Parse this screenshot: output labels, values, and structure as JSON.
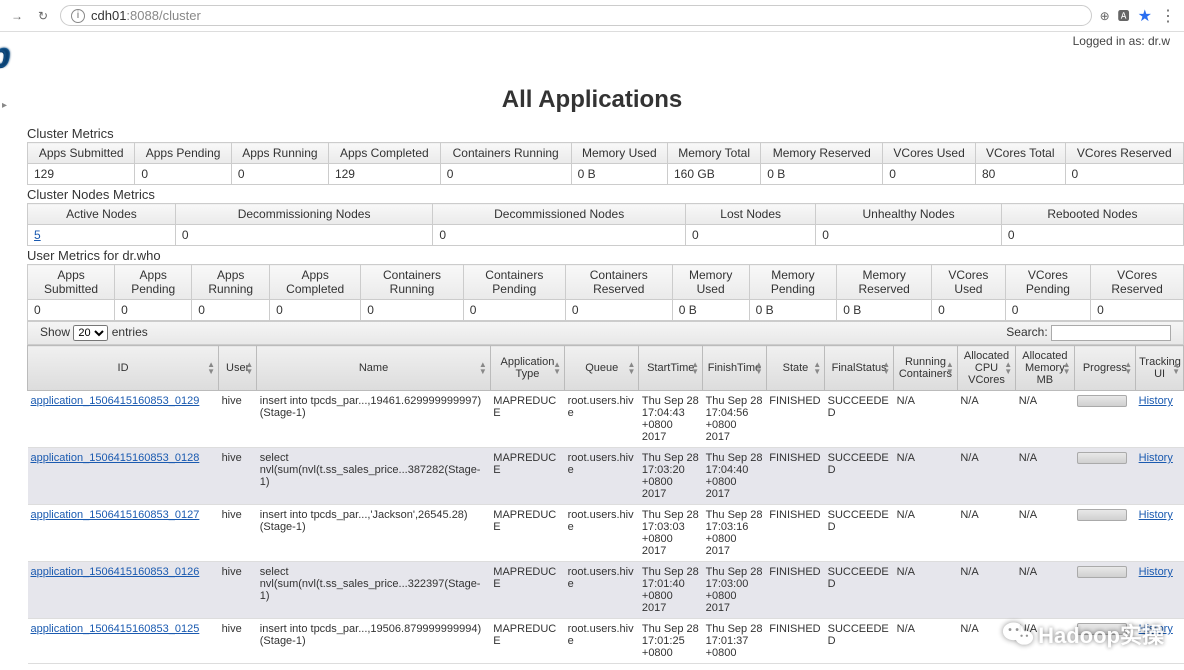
{
  "browser": {
    "url_host": "cdh01",
    "url_rest": ":8088/cluster"
  },
  "logged_in": "Logged in as: dr.w",
  "logo_text": "op",
  "page_title": "All Applications",
  "sections": {
    "cluster_metrics": "Cluster Metrics",
    "cluster_nodes": "Cluster Nodes Metrics",
    "user_metrics": "User Metrics for dr.who"
  },
  "cluster_metrics": {
    "headers": [
      "Apps Submitted",
      "Apps Pending",
      "Apps Running",
      "Apps Completed",
      "Containers Running",
      "Memory Used",
      "Memory Total",
      "Memory Reserved",
      "VCores Used",
      "VCores Total",
      "VCores Reserved"
    ],
    "values": [
      "129",
      "0",
      "0",
      "129",
      "0",
      "0 B",
      "160 GB",
      "0 B",
      "0",
      "80",
      "0"
    ]
  },
  "nodes_metrics": {
    "headers": [
      "Active Nodes",
      "Decommissioning Nodes",
      "Decommissioned Nodes",
      "Lost Nodes",
      "Unhealthy Nodes",
      "Rebooted Nodes"
    ],
    "values": [
      "5",
      "0",
      "0",
      "0",
      "0",
      "0"
    ],
    "link_idx": 0
  },
  "user_metrics": {
    "headers": [
      "Apps Submitted",
      "Apps Pending",
      "Apps Running",
      "Apps Completed",
      "Containers Running",
      "Containers Pending",
      "Containers Reserved",
      "Memory Used",
      "Memory Pending",
      "Memory Reserved",
      "VCores Used",
      "VCores Pending",
      "VCores Reserved"
    ],
    "values": [
      "0",
      "0",
      "0",
      "0",
      "0",
      "0",
      "0",
      "0 B",
      "0 B",
      "0 B",
      "0",
      "0",
      "0"
    ]
  },
  "table_controls": {
    "show_prefix": "Show",
    "show_value": "20",
    "show_suffix": "entries",
    "search_label": "Search:"
  },
  "apps_headers": [
    "ID",
    "User",
    "Name",
    "Application Type",
    "Queue",
    "StartTime",
    "FinishTime",
    "State",
    "FinalStatus",
    "Running Containers",
    "Allocated CPU VCores",
    "Allocated Memory MB",
    "Progress",
    "Tracking UI"
  ],
  "apps": [
    {
      "id": "application_1506415160853_0129",
      "user": "hive",
      "name": "insert into tpcds_par...,19461.629999999997)(Stage-1)",
      "type": "MAPREDUCE",
      "queue": "root.users.hive",
      "start": "Thu Sep 28 17:04:43 +0800 2017",
      "finish": "Thu Sep 28 17:04:56 +0800 2017",
      "state": "FINISHED",
      "final": "SUCCEEDED",
      "running": "N/A",
      "cpu": "N/A",
      "mem": "N/A",
      "track": "History"
    },
    {
      "id": "application_1506415160853_0128",
      "user": "hive",
      "name": "select nvl(sum(nvl(t.ss_sales_price...387282(Stage-1)",
      "type": "MAPREDUCE",
      "queue": "root.users.hive",
      "start": "Thu Sep 28 17:03:20 +0800 2017",
      "finish": "Thu Sep 28 17:04:40 +0800 2017",
      "state": "FINISHED",
      "final": "SUCCEEDED",
      "running": "N/A",
      "cpu": "N/A",
      "mem": "N/A",
      "track": "History"
    },
    {
      "id": "application_1506415160853_0127",
      "user": "hive",
      "name": "insert into tpcds_par...,'Jackson',26545.28)(Stage-1)",
      "type": "MAPREDUCE",
      "queue": "root.users.hive",
      "start": "Thu Sep 28 17:03:03 +0800 2017",
      "finish": "Thu Sep 28 17:03:16 +0800 2017",
      "state": "FINISHED",
      "final": "SUCCEEDED",
      "running": "N/A",
      "cpu": "N/A",
      "mem": "N/A",
      "track": "History"
    },
    {
      "id": "application_1506415160853_0126",
      "user": "hive",
      "name": "select nvl(sum(nvl(t.ss_sales_price...322397(Stage-1)",
      "type": "MAPREDUCE",
      "queue": "root.users.hive",
      "start": "Thu Sep 28 17:01:40 +0800 2017",
      "finish": "Thu Sep 28 17:03:00 +0800 2017",
      "state": "FINISHED",
      "final": "SUCCEEDED",
      "running": "N/A",
      "cpu": "N/A",
      "mem": "N/A",
      "track": "History"
    },
    {
      "id": "application_1506415160853_0125",
      "user": "hive",
      "name": "insert into tpcds_par...,19506.879999999994)(Stage-1)",
      "type": "MAPREDUCE",
      "queue": "root.users.hive",
      "start": "Thu Sep 28 17:01:25 +0800",
      "finish": "Thu Sep 28 17:01:37 +0800",
      "state": "FINISHED",
      "final": "SUCCEEDED",
      "running": "N/A",
      "cpu": "N/A",
      "mem": "N/A",
      "track": "History"
    }
  ],
  "watermark": "Hadoop实操"
}
